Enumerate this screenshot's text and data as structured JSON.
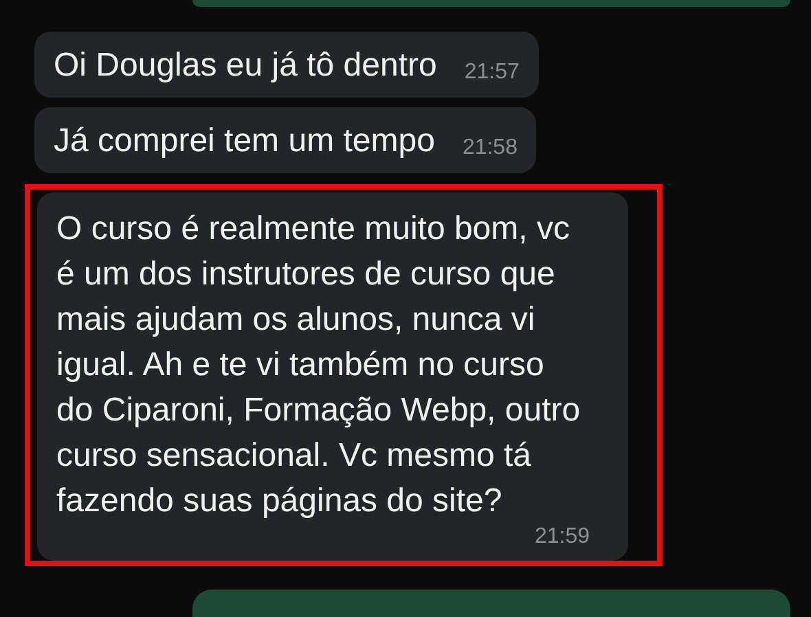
{
  "messages": [
    {
      "kind": "outgoing"
    },
    {
      "kind": "incoming",
      "text": "Oi Douglas eu já tô dentro",
      "time": "21:57",
      "highlighted": false
    },
    {
      "kind": "incoming",
      "text": "Já comprei tem um tempo",
      "time": "21:58",
      "highlighted": false
    },
    {
      "kind": "incoming",
      "text": "O curso é realmente muito bom, vc é um dos instrutores de curso que mais ajudam os alunos, nunca vi igual. Ah e te vi também no curso do Ciparoni, Formação Webp, outro curso sensacional. Vc mesmo tá fazendo suas páginas do site?",
      "time": "21:59",
      "highlighted": true
    },
    {
      "kind": "outgoing"
    }
  ]
}
